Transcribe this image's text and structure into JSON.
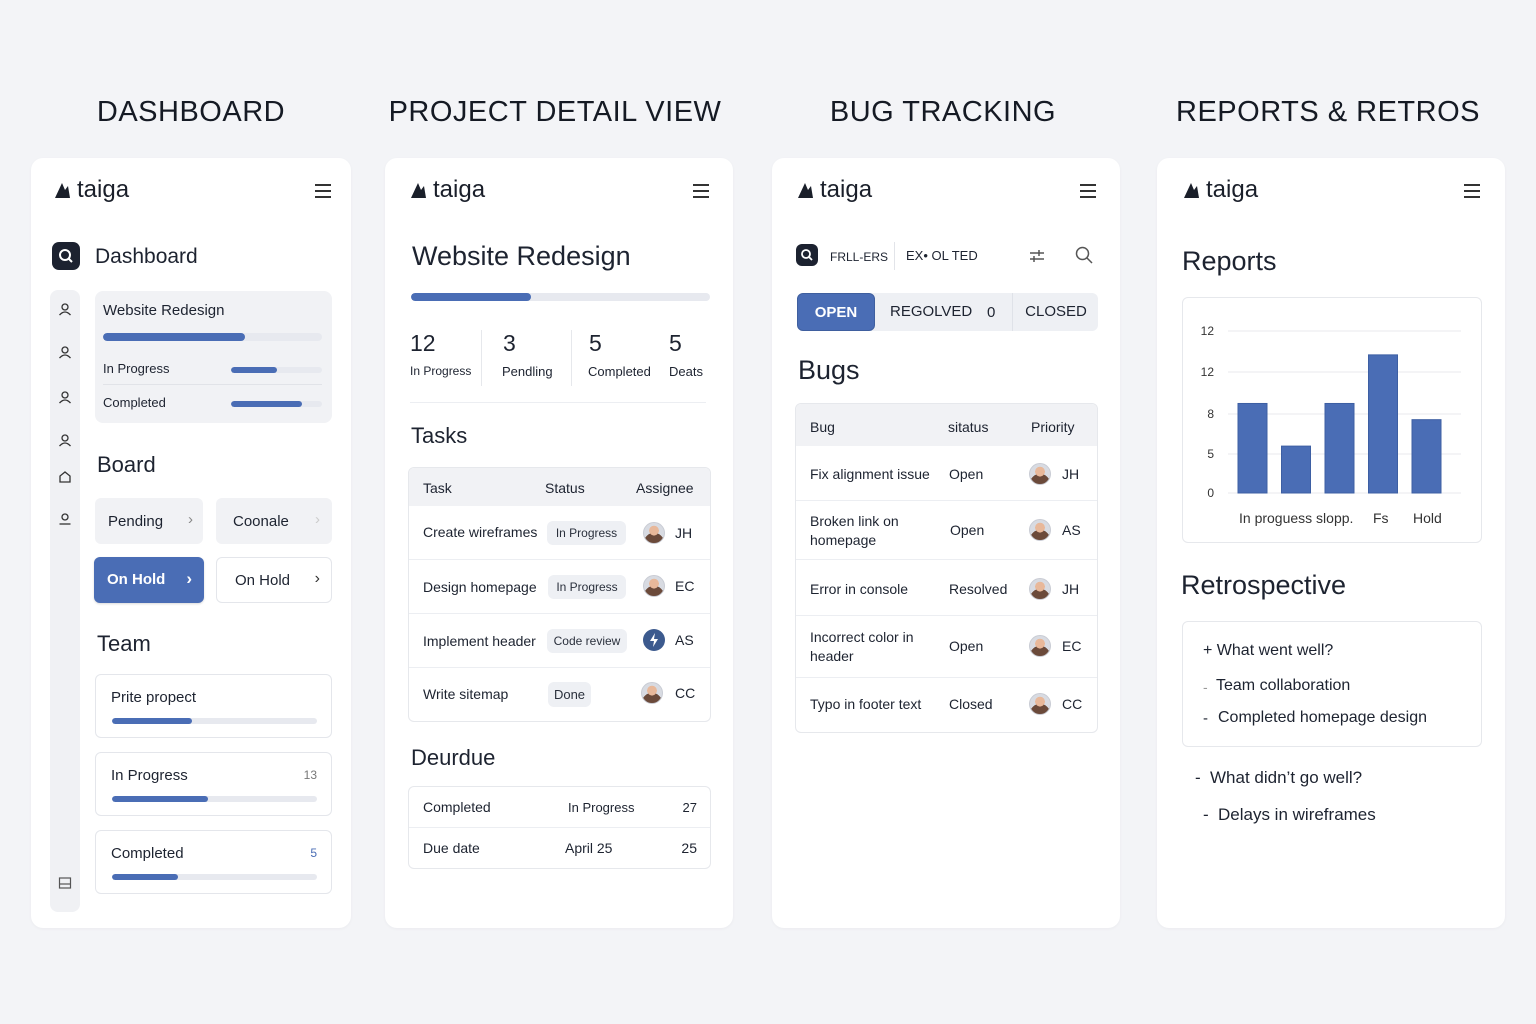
{
  "sections": [
    "DASHBOARD",
    "PROJECT DETAIL VIEW",
    "BUG TRACKING",
    "REPORTS & RETROS"
  ],
  "brand": "taiga",
  "colors": {
    "accent": "#4a6db5",
    "background": "#f3f4f7",
    "panel": "#ffffff"
  },
  "dashboard": {
    "title": "Dashboard",
    "project_card": {
      "name": "Website Redesign",
      "progress": 0.65,
      "rows": [
        {
          "label": "In Progress",
          "progress": 0.5
        },
        {
          "label": "Completed",
          "progress": 0.78
        }
      ]
    },
    "board_heading": "Board",
    "board_buttons": [
      {
        "label": "Pending",
        "chevron": "›",
        "active": false
      },
      {
        "label": "Coonale",
        "chevron": "›",
        "active": false
      },
      {
        "label": "On Hold",
        "chevron": "›",
        "active": true
      },
      {
        "label": "On Hold",
        "chevron": "›",
        "active": false
      }
    ],
    "team_heading": "Team",
    "team_cards": [
      {
        "label": "Prite propect",
        "count": "",
        "progress": 0.39
      },
      {
        "label": "In Progress",
        "count": "13",
        "progress": 0.47
      },
      {
        "label": "Completed",
        "count": "5",
        "progress": 0.32
      }
    ]
  },
  "project": {
    "title": "Website Redesign",
    "progress": 0.4,
    "stats": [
      {
        "value": "12",
        "label": "In Progress"
      },
      {
        "value": "3",
        "label": "Pendling"
      },
      {
        "value": "5",
        "label": "Completed"
      },
      {
        "value": "5",
        "label": "Deats"
      }
    ],
    "tasks_heading": "Tasks",
    "task_headers": [
      "Task",
      "Status",
      "Assignee"
    ],
    "tasks": [
      {
        "task": "Create wireframes",
        "status": "In Progress",
        "assignee": "JH",
        "icon": "avatar"
      },
      {
        "task": "Design homepage",
        "status": "In Progress",
        "assignee": "EC",
        "icon": "avatar"
      },
      {
        "task": "Implement header",
        "status": "Code review",
        "assignee": "AS",
        "icon": "bolt-icon"
      },
      {
        "task": "Write sitemap",
        "status": "Done",
        "assignee": "CC",
        "icon": "avatar"
      }
    ],
    "due_heading": "Deurdue",
    "due_rows": [
      {
        "label": "Completed",
        "value": "In Progress",
        "count": "27"
      },
      {
        "label": "Due date",
        "value": "April 25",
        "count": "25"
      }
    ]
  },
  "bugs": {
    "filter_label": "FRLL-ERS",
    "filter_value": "EX• OL TED",
    "tabs": [
      {
        "label": "OPEN",
        "active": true
      },
      {
        "label": "REGOLVED",
        "count": "0",
        "active": false
      },
      {
        "label": "CLOSED",
        "active": false
      }
    ],
    "heading": "Bugs",
    "headers": [
      "Bug",
      "sitatus",
      "Priority"
    ],
    "rows": [
      {
        "bug": "Fix alignment issue",
        "status": "Open",
        "assignee": "JH"
      },
      {
        "bug": "Broken link on homepage",
        "status": "Open",
        "assignee": "AS"
      },
      {
        "bug": "Error in console",
        "status": "Resolved",
        "assignee": "JH"
      },
      {
        "bug": "Incorrect color in header",
        "status": "Open",
        "assignee": "EC"
      },
      {
        "bug": "Typo in footer text",
        "status": "Closed",
        "assignee": "CC"
      }
    ]
  },
  "reports": {
    "heading": "Reports",
    "chart_data": {
      "type": "bar",
      "y_ticks": [
        "12",
        "12",
        "8",
        "5",
        "0"
      ],
      "values": [
        10.5,
        5.5,
        10.5,
        16.2,
        8.6
      ],
      "ylim": [
        0,
        19
      ],
      "x_tick_labels": [
        "In proguess slopp.",
        "Fs",
        "Hold"
      ],
      "grid": true
    },
    "retro_heading": "Retrospective",
    "went_well_title": "+ What went well?",
    "went_well_items": [
      "Team collaboration",
      "Completed homepage design"
    ],
    "not_well_title": "What didn’t go well?",
    "not_well_items": [
      "Delays in wireframes"
    ]
  }
}
